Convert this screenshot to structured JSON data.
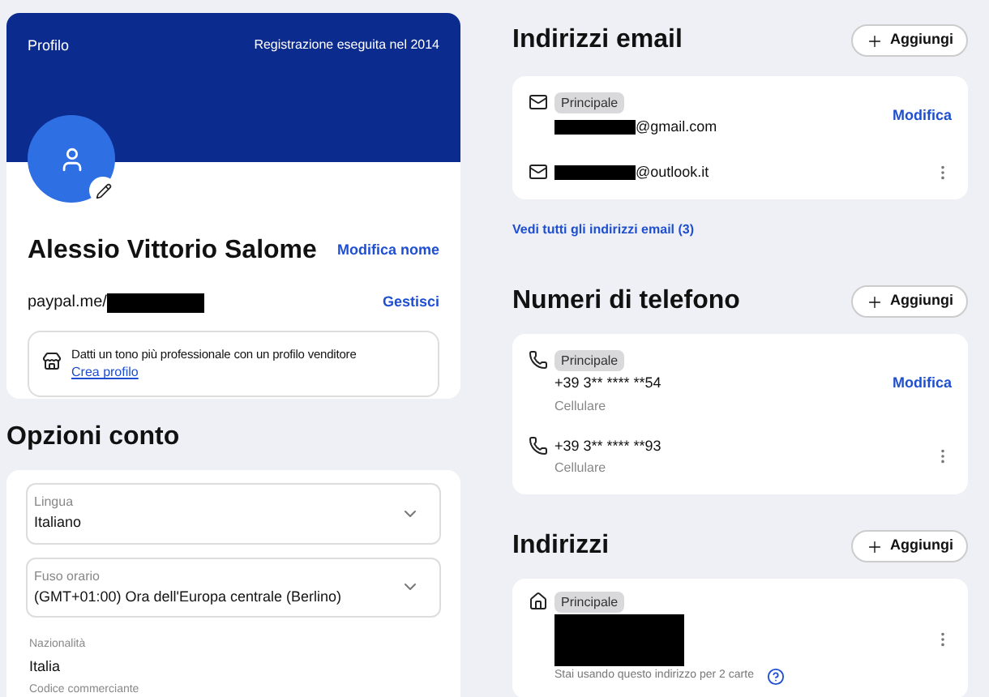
{
  "profile": {
    "title": "Profilo",
    "registered": "Registrazione eseguita nel 2014",
    "name": "Alessio Vittorio Salome",
    "edit_name": "Modifica nome",
    "paypal_me": "paypal.me/",
    "manage": "Gestisci",
    "seller_promo": {
      "text": "Datti un tono più professionale con un profilo venditore",
      "link": "Crea profilo"
    }
  },
  "account_options": {
    "title": "Opzioni conto",
    "selects": [
      {
        "label": "Lingua",
        "value": "Italiano"
      },
      {
        "label": "Fuso orario",
        "value": "(GMT+01:00) Ora dell'Europa centrale (Berlino)"
      }
    ],
    "fields": [
      {
        "label": "Nazionalità",
        "value": "Italia"
      },
      {
        "label": "Codice commerciante"
      }
    ]
  },
  "emails": {
    "title": "Indirizzi email",
    "add": "Aggiungi",
    "items": [
      {
        "badge": "Principale",
        "address": "@gmail.com",
        "action": "Modifica"
      },
      {
        "address": "@outlook.it"
      }
    ],
    "see_all": "Vedi tutti gli indirizzi email (3)"
  },
  "phones": {
    "title": "Numeri di telefono",
    "add": "Aggiungi",
    "items": [
      {
        "badge": "Principale",
        "number": "+39 3** **** **54",
        "type": "Cellulare",
        "action": "Modifica"
      },
      {
        "number": "+39 3** **** **93",
        "type": "Cellulare"
      }
    ]
  },
  "addresses": {
    "title": "Indirizzi",
    "add": "Aggiungi",
    "items": [
      {
        "badge": "Principale",
        "note": "Stai usando questo indirizzo per 2 carte"
      }
    ]
  }
}
